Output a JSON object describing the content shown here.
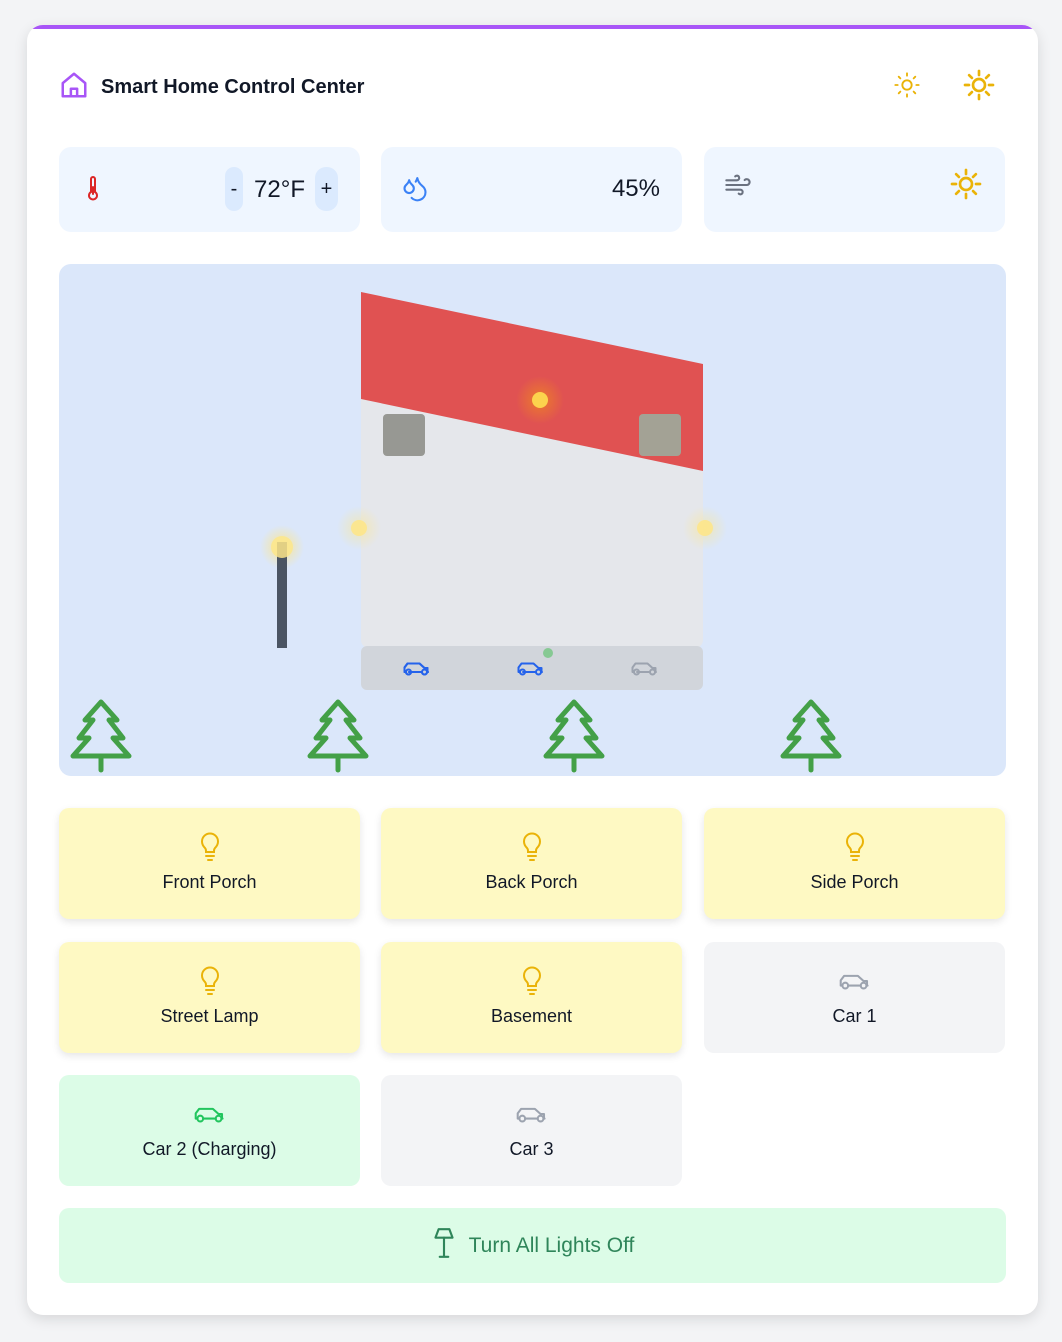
{
  "header": {
    "title": "Smart Home Control Center"
  },
  "climate": {
    "temperature": "72°F",
    "decrease_label": "-",
    "increase_label": "+",
    "humidity": "45%"
  },
  "devices": [
    {
      "label": "Front Porch",
      "icon": "lightbulb-icon",
      "state": "on"
    },
    {
      "label": "Back Porch",
      "icon": "lightbulb-icon",
      "state": "on"
    },
    {
      "label": "Side Porch",
      "icon": "lightbulb-icon",
      "state": "on"
    },
    {
      "label": "Street Lamp",
      "icon": "lightbulb-icon",
      "state": "on"
    },
    {
      "label": "Basement",
      "icon": "lightbulb-icon",
      "state": "on"
    },
    {
      "label": "Car 1",
      "icon": "car-icon",
      "state": "off"
    },
    {
      "label": "Car 2 (Charging)",
      "icon": "car-icon",
      "state": "charging"
    },
    {
      "label": "Car 3",
      "icon": "car-icon",
      "state": "off"
    }
  ],
  "actions": {
    "all_lights_off": "Turn All Lights Off"
  },
  "colors": {
    "accent": "#a855f7",
    "light_on": "#fef9c3",
    "bulb": "#eab308",
    "charging": "#dcfce7",
    "roof": "#e05252",
    "tree": "#43a047"
  }
}
